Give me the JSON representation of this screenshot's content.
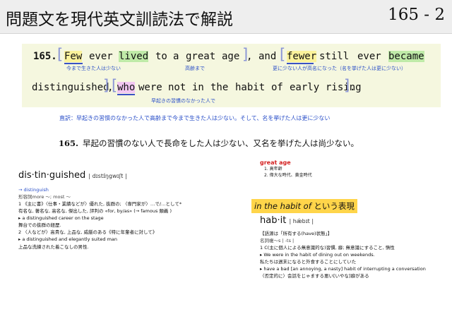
{
  "header": {
    "title": "問題文を現代英文訓読法で解説",
    "page_number": "165 - 2"
  },
  "sentence": {
    "number": "165.",
    "line1": {
      "few": "Few",
      "ever": "ever",
      "lived": "lived",
      "to": "to",
      "a": "a",
      "great": "great",
      "age_word": "age",
      "comma": ",",
      "and": "and",
      "fewer": "fewer",
      "still": "still",
      "ever2": "ever",
      "became": "became"
    },
    "gloss1": {
      "few": "今まで生きた人は少ない",
      "great_age": "高齢まで",
      "fewer": "更に少ない人が高名になった（名を挙げた人は更に少ない）"
    },
    "line2": {
      "distinguished": "distinguished",
      "comma": ",",
      "who": "who",
      "were": "were",
      "not": "not",
      "in": "in",
      "the": "the",
      "habit": "habit",
      "of": "of",
      "early": "early",
      "rising": "rising",
      "period": "."
    },
    "gloss2": {
      "who": "早起きの習慣のなかった人で"
    }
  },
  "translation": {
    "literal": "直訳：早起きの習慣のなかった人で高齢まで今まで生きた人は少ない。そして、名を挙げた人は更に少ない",
    "final_number": "165.",
    "final_text": "早起の習慣のない人で長命をした人は少ない、又名を挙げた人は尚少ない。"
  },
  "dict_distinguished": {
    "headword": "dis·tin·guished",
    "pron": "| dɪstɪ́ŋgwɪʃt |",
    "lines": [
      "→ distinguish",
      "形容詞more 〜; most 〜",
      "1 《主に書》〈仕事・業績などが〉優れた, 抜群の; 〈専門家が〉…で/…として*",
      "有名な, 著名な, 高名な, 傑出した, 評判の «for, by/as» (→ famous 類義 )",
      "▸ a distinguished career on the stage",
      "舞台での抜群の経歴.",
      "2 〈人などが〉高貴な, 上品な, 威厳のある《特に年輩者に対して》",
      "▸ a distinguished and elegantly suited man",
      "上品な洗練された着こなしの男性."
    ]
  },
  "great_age": {
    "title": "great age",
    "items": [
      "1. 高年齢",
      "2. 偉大な時代、黄金時代"
    ]
  },
  "habit_section": {
    "title_italic": "in the habit of",
    "title_rest": "という表現"
  },
  "dict_habit": {
    "headword": "hab·it",
    "pron": "| hǽbɪt |",
    "lines": [
      "【語源は「所有する(have)状態」】",
      "名詞複〜s | -ts |",
      "1 C(主に個人による無意識的な)習慣, 癖; 無意識にすること, 惰性",
      "▸ We were in the habit of dining out on weekends.",
      "私たちは週末になると外食することにしていた",
      "▸ have a bad [an annoying, a nasty] habit of interrupting a conversation",
      "〈否定的に〉会話をじゃまする悪い[いやな]癖がある"
    ]
  },
  "colors": {
    "box_bg": "#f5f7df",
    "highlight_yellow": "#fbf29b",
    "highlight_green": "#bfeaa8",
    "highlight_purple": "#f2c7f2",
    "gloss_blue": "#2a4fc8",
    "great_age_red": "#d32020",
    "habit_title_bg": "#ffd54a"
  }
}
